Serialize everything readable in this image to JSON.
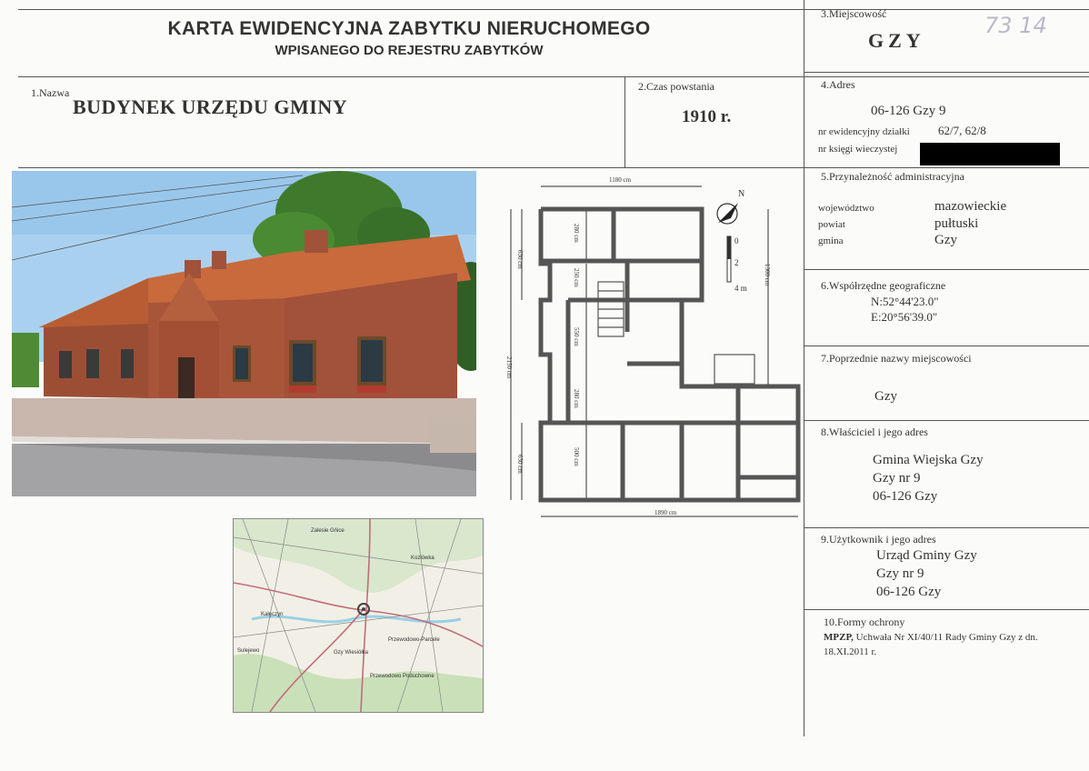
{
  "header": {
    "title": "KARTA EWIDENCYJNA ZABYTKU NIERUCHOMEGO",
    "subtitle": "WPISANEGO DO REJESTRU ZABYTKÓW"
  },
  "handwritten_number": "73 14",
  "field1": {
    "label": "1.Nazwa",
    "value": "BUDYNEK URZĘDU GMINY"
  },
  "field2": {
    "label": "2.Czas powstania",
    "value": "1910 r."
  },
  "field3": {
    "label": "3.Miejscowość",
    "value": "GZY"
  },
  "field4": {
    "label": "4.Adres",
    "address": "06-126 Gzy 9",
    "parcel_label": "nr ewidencyjny działki",
    "parcel_value": "62/7, 62/8",
    "register_label": "nr księgi wieczystej"
  },
  "field5": {
    "label": "5.Przynależność administracyjna",
    "rows": [
      {
        "key": "województwo",
        "value": "mazowieckie"
      },
      {
        "key": "powiat",
        "value": "pułtuski"
      },
      {
        "key": "gmina",
        "value": "Gzy"
      }
    ]
  },
  "field6": {
    "label": "6.Współrzędne geograficzne",
    "n": "N:52°44'23.0\"",
    "e": "E:20°56'39.0\""
  },
  "field7": {
    "label": "7.Poprzednie nazwy miejscowości",
    "value": "Gzy"
  },
  "field8": {
    "label": "8.Właściciel i jego adres",
    "lines": [
      "Gmina Wiejska Gzy",
      "Gzy nr 9",
      "06-126 Gzy"
    ]
  },
  "field9": {
    "label": "9.Użytkownik i jego adres",
    "lines": [
      "Urząd Gminy Gzy",
      "Gzy nr 9",
      "06-126 Gzy"
    ]
  },
  "field10": {
    "label": "10.Formy ochrony",
    "bold": "MPZP,",
    "text1": " Uchwała Nr XI/40/11 Rady Gminy Gzy z dn.",
    "text2": "18.XI.2011 r."
  },
  "plan": {
    "dim_top": "1180 cm",
    "dim_bottom": "1890 cm",
    "dim_left_total": "2150 cm",
    "dim_left_top": "630 cm",
    "dim_left_bottom": "630 cm",
    "dim_right": "1300 cm",
    "dim_280a": "280 cm",
    "dim_250": "250 cm",
    "dim_550": "550 cm",
    "dim_280b": "280 cm",
    "dim_500": "500 cm",
    "north": "N",
    "scale_0": "0",
    "scale_2": "2",
    "scale_4": "4 m"
  },
  "map_labels": [
    "Zalesie Gńice",
    "Kozłówka",
    "Kałęczyn",
    "Sulejewo",
    "Gzy Wiesiółka",
    "Przewodowo-Parcele",
    "Przewodowo Poduchowne"
  ],
  "colors": {
    "brick": "#a8553a",
    "roof": "#c7683c",
    "sky": "#9ec7ea",
    "grass": "#7ea24a"
  }
}
